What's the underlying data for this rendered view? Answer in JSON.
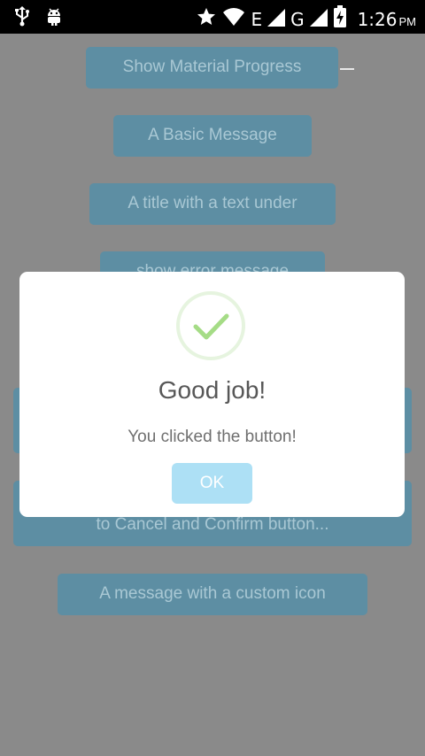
{
  "status_bar": {
    "left_icons": [
      "usb-icon",
      "android-debug-icon"
    ],
    "right_icons": [
      "star-icon",
      "wifi-icon",
      "signal-e-icon",
      "signal-g-icon",
      "battery-charging-icon"
    ],
    "network_e": "E",
    "network_g": "G",
    "time": "1:26",
    "ampm": "PM"
  },
  "buttons": [
    "Show Material Progress",
    "A Basic Message",
    "A title with a text under",
    "show error message",
    "",
    "to Cancel and Confirm button...",
    "A message with a custom icon"
  ],
  "dialog": {
    "icon": "success-check-icon",
    "title": "Good job!",
    "message": "You clicked the button!",
    "ok_label": "OK",
    "colors": {
      "check": "#a5dc86",
      "ok_button": "#ade0f5"
    }
  }
}
